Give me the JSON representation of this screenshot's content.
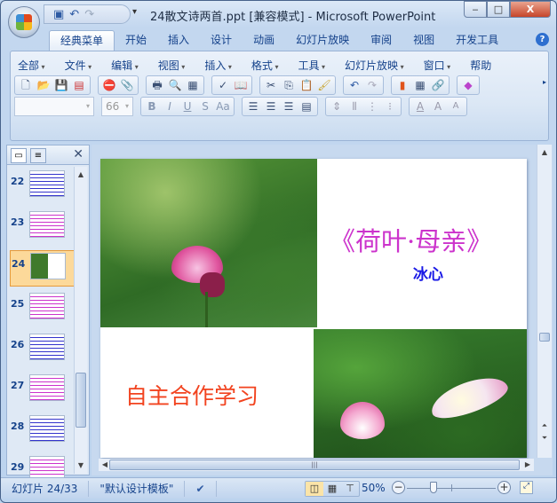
{
  "window": {
    "title": "24散文诗两首.ppt [兼容模式] - Microsoft PowerPoint",
    "controls": {
      "minimize": "‒",
      "maximize": "□",
      "close": "X"
    }
  },
  "quick_access": {
    "save": "save-icon",
    "undo": "undo-icon",
    "redo": "redo-icon",
    "more": "▾"
  },
  "tabs": [
    "经典菜单",
    "开始",
    "插入",
    "设计",
    "动画",
    "幻灯片放映",
    "审阅",
    "视图",
    "开发工具"
  ],
  "help": "?",
  "menu": [
    "全部",
    "文件",
    "编辑",
    "视图",
    "插入",
    "格式",
    "工具",
    "幻灯片放映",
    "窗口",
    "帮助"
  ],
  "format_bar": {
    "font_name": "",
    "font_size": "66"
  },
  "slides_panel": {
    "close": "✕",
    "slides": [
      {
        "number": "22",
        "selected": false
      },
      {
        "number": "23",
        "selected": false
      },
      {
        "number": "24",
        "selected": true
      },
      {
        "number": "25",
        "selected": false
      },
      {
        "number": "26",
        "selected": false
      },
      {
        "number": "27",
        "selected": false
      },
      {
        "number": "28",
        "selected": false
      },
      {
        "number": "29",
        "selected": false
      }
    ]
  },
  "slide": {
    "title": "《荷叶·母亲》",
    "author": "冰心",
    "subtitle": "自主合作学习",
    "colors": {
      "title": "#cc33cc",
      "author": "#1a1ae6",
      "subtitle": "#f2431f"
    }
  },
  "status_bar": {
    "slide_counter": "幻灯片 24/33",
    "template": "\"默认设计模板\"",
    "zoom": "50%",
    "zoom_fraction": 0.3
  }
}
